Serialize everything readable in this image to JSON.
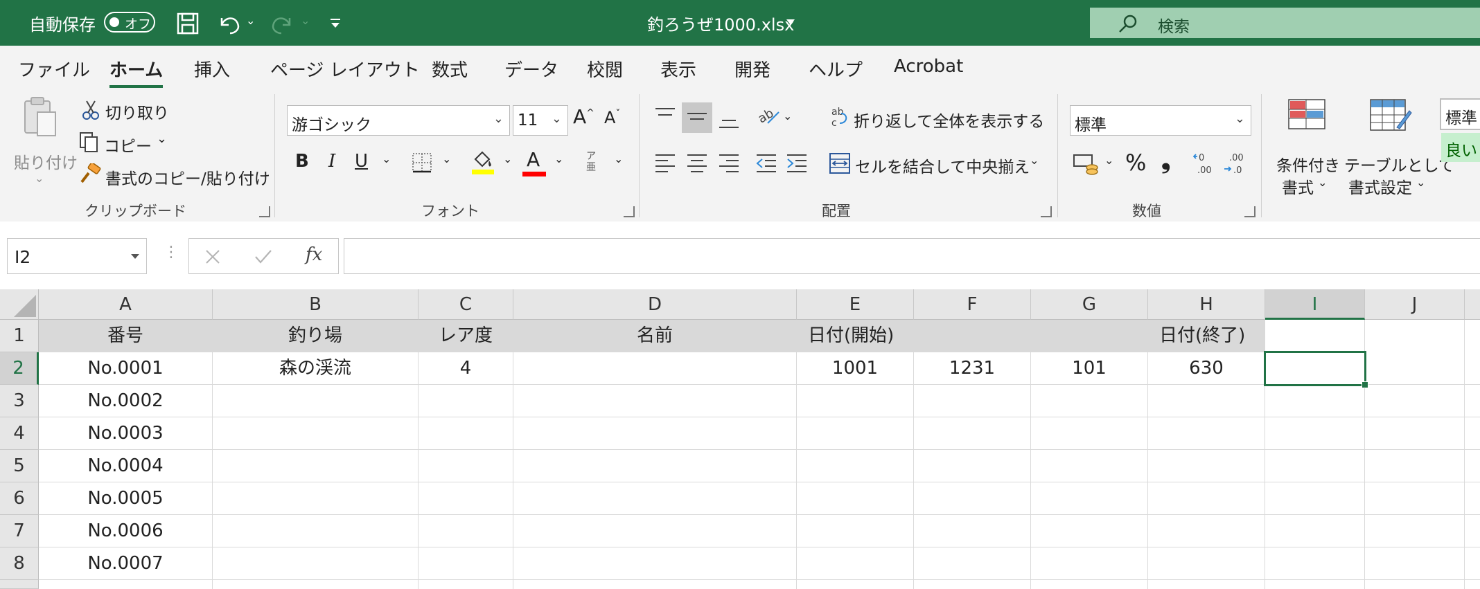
{
  "titlebar": {
    "autosave_label": "自動保存",
    "autosave_state": "オフ",
    "filename": "釣ろうぜ1000.xlsx",
    "search_placeholder": "検索"
  },
  "menu": {
    "tabs": [
      "ファイル",
      "ホーム",
      "挿入",
      "ページ レイアウト",
      "数式",
      "データ",
      "校閲",
      "表示",
      "開発",
      "ヘルプ",
      "Acrobat"
    ],
    "active": "ホーム"
  },
  "ribbon": {
    "clipboard": {
      "paste": "貼り付け",
      "cut": "切り取り",
      "copy": "コピー",
      "format_painter": "書式のコピー/貼り付け",
      "group_label": "クリップボード"
    },
    "font": {
      "font_name": "游ゴシック",
      "font_size": "11",
      "bold": "B",
      "italic": "I",
      "underline": "U",
      "font_color_glyph": "A",
      "phonetic_glyph": "ア亜",
      "group_label": "フォント",
      "fill_color": "#ffff00",
      "text_color": "#ff0000"
    },
    "alignment": {
      "wrap_text": "折り返して全体を表示する",
      "merge_center": "セルを結合して中央揃え",
      "group_label": "配置"
    },
    "number": {
      "format": "標準",
      "percent": "%",
      "comma": "❟",
      "group_label": "数値"
    },
    "styles": {
      "conditional_l1": "条件付き",
      "conditional_l2": "書式",
      "table_l1": "テーブルとして",
      "table_l2": "書式設定",
      "style_standard": "標準",
      "style_good": "良い"
    }
  },
  "formula_bar": {
    "name_box": "I2",
    "fx": "fx",
    "content": ""
  },
  "grid": {
    "columns": [
      "A",
      "B",
      "C",
      "D",
      "E",
      "F",
      "G",
      "H",
      "I",
      "J"
    ],
    "selected_column": "I",
    "row_numbers": [
      "1",
      "2",
      "3",
      "4",
      "5",
      "6",
      "7",
      "8"
    ],
    "selected_row": "2",
    "header_row": {
      "A": "番号",
      "B": "釣り場",
      "C": "レア度",
      "D": "名前",
      "E": "日付(開始)",
      "H": "日付(終了)"
    },
    "row2": {
      "A": "No.0001",
      "B": "森の渓流",
      "C": "4",
      "E": "1001",
      "F": "1231",
      "G": "101",
      "H": "630"
    },
    "col_a_values": [
      "No.0002",
      "No.0003",
      "No.0004",
      "No.0005",
      "No.0006",
      "No.0007"
    ],
    "active_cell": "I2"
  },
  "colors": {
    "accent": "#217346",
    "search_bg": "#a0cfb1",
    "header_fill": "#d9d9d9"
  }
}
